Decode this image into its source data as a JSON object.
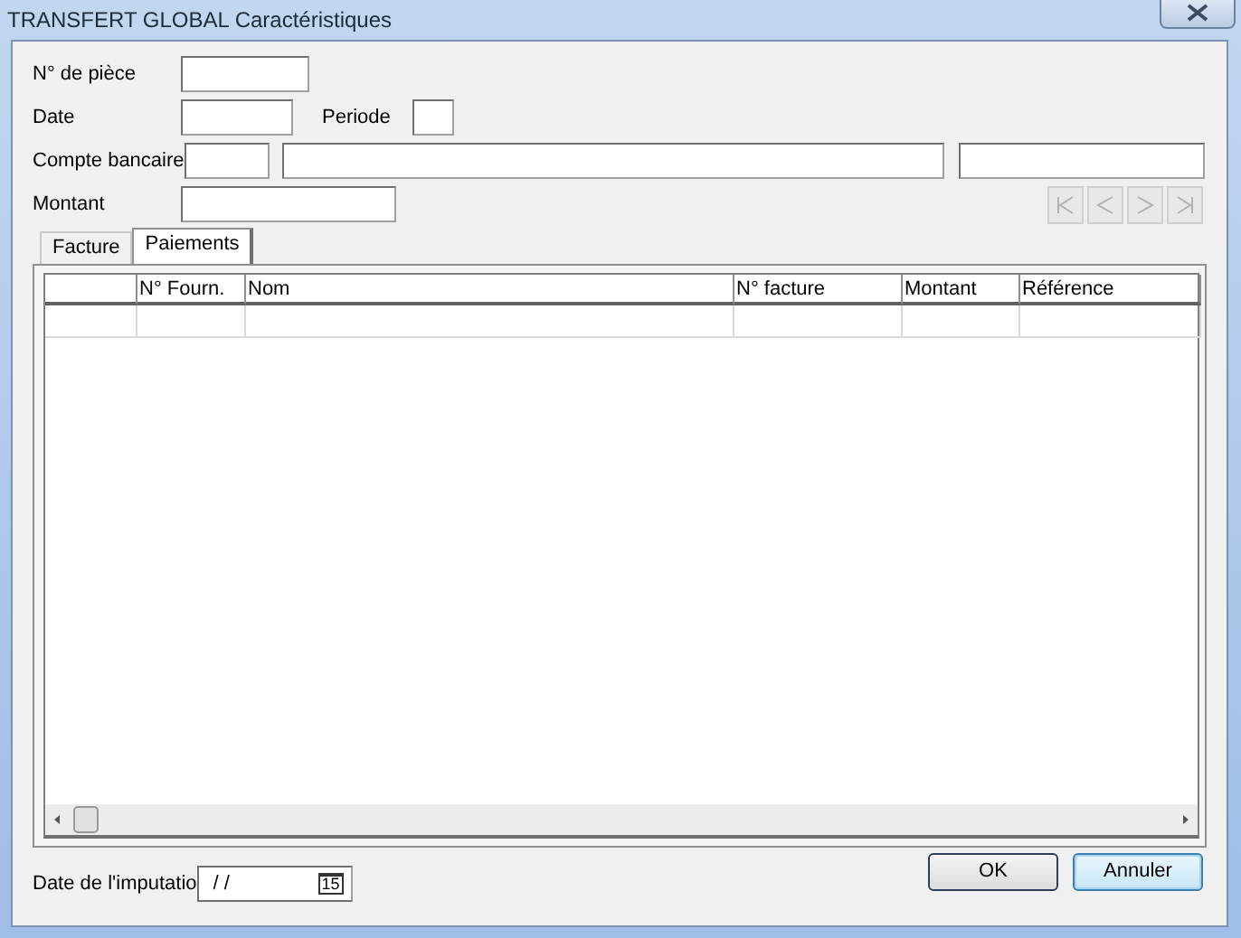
{
  "window": {
    "title": "TRANSFERT GLOBAL Caractéristiques"
  },
  "form": {
    "piece_label": "N° de pièce",
    "date_label": "Date",
    "periode_label": "Periode",
    "compte_label": "Compte bancaire",
    "montant_label": "Montant"
  },
  "tabs": [
    {
      "label": "Facture",
      "selected": false
    },
    {
      "label": "Paiements",
      "selected": true
    }
  ],
  "table": {
    "columns": [
      "",
      "N° Fourn.",
      "Nom",
      "N° facture",
      "Montant",
      "Référence"
    ]
  },
  "footer": {
    "imputation_label": "Date de l'imputatio",
    "imputation_value": "/ /",
    "calendar_icon_text": "15"
  },
  "buttons": [
    {
      "label": "OK",
      "default": false
    },
    {
      "label": "Annuler",
      "default": true
    }
  ]
}
